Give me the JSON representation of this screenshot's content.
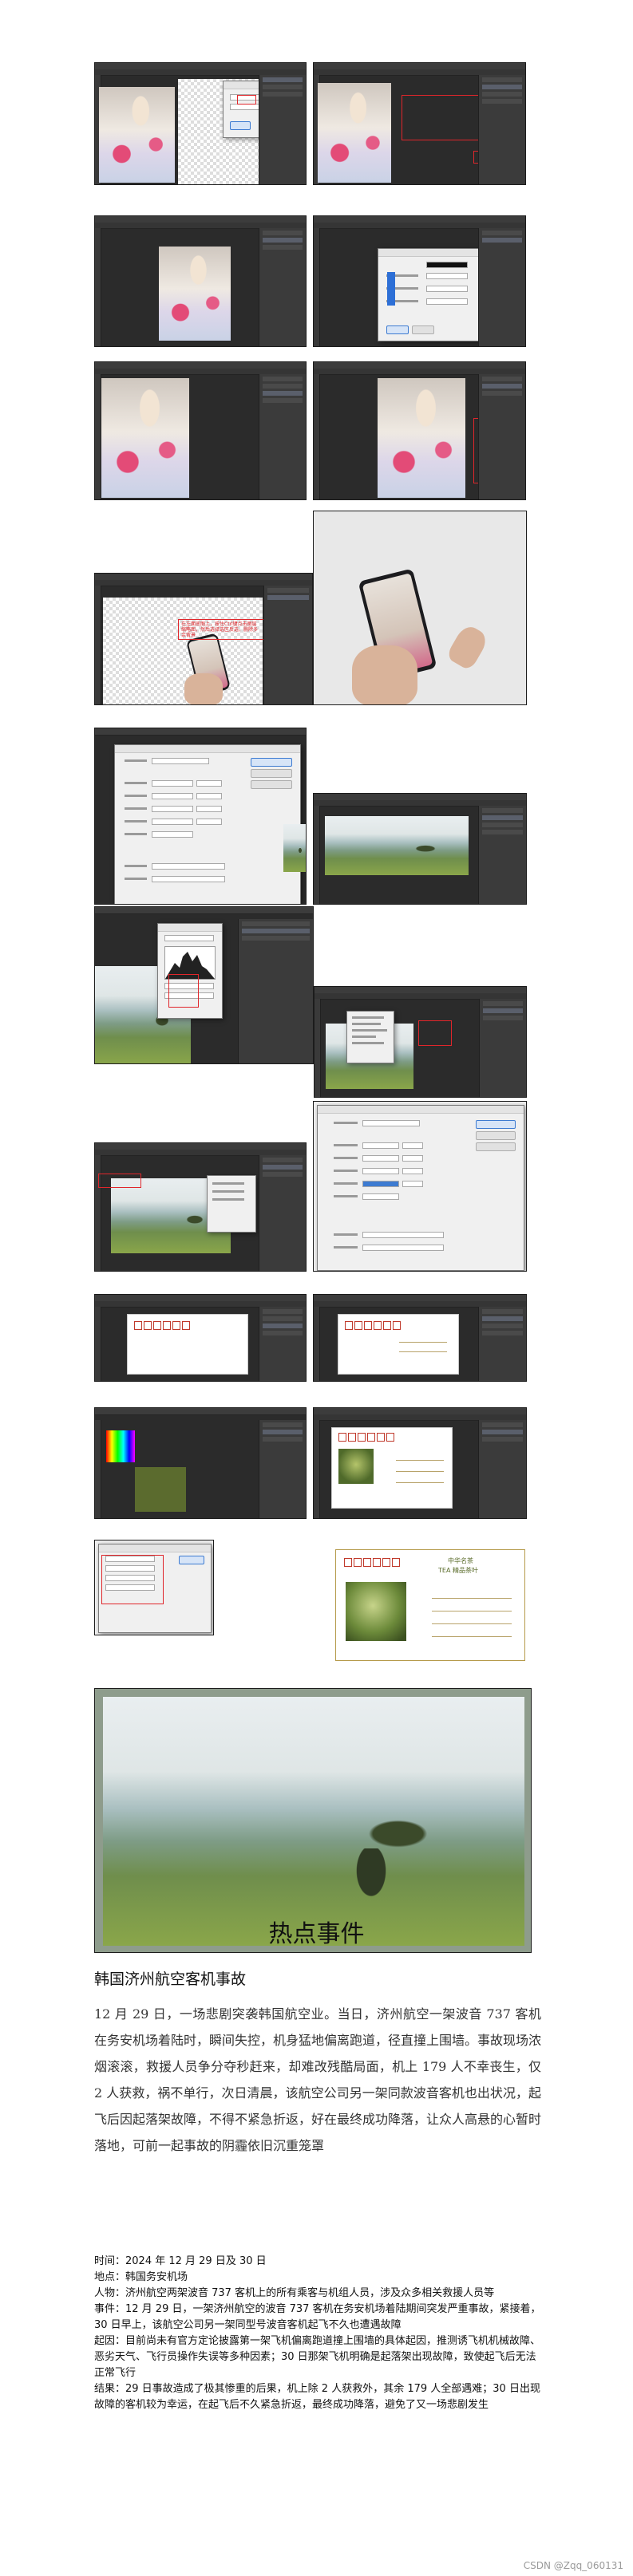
{
  "steps": [
    {
      "name": "step-1-open-portrait"
    },
    {
      "name": "step-2-select-subject"
    },
    {
      "name": "step-3-mask-portrait"
    },
    {
      "name": "step-4-refine-edge-dialog"
    },
    {
      "name": "step-5-layers-portrait"
    },
    {
      "name": "step-6-adjust-portrait"
    },
    {
      "name": "step-7-transparent-canvas"
    },
    {
      "name": "step-8-phone-photo"
    },
    {
      "name": "step-9-new-document-dialog"
    },
    {
      "name": "step-10-place-tea-photo"
    },
    {
      "name": "step-11-levels"
    },
    {
      "name": "step-12-context-menu"
    },
    {
      "name": "step-13-tea-layer"
    },
    {
      "name": "step-14-canvas-size-dialog"
    },
    {
      "name": "step-15-postcard-frame"
    },
    {
      "name": "step-16-postcard-frame-layers"
    },
    {
      "name": "step-17-color-picker"
    },
    {
      "name": "step-18-postcard-with-photo"
    },
    {
      "name": "step-19-character-panel"
    },
    {
      "name": "step-20-final-postcard"
    },
    {
      "name": "step-21-final-tea-image"
    }
  ],
  "annotations": {
    "step7_note": "在左面底图上，按住Ctrl键点击图层缩略图，然后选择选区反选，删除多余背景"
  },
  "postcard": {
    "title_line1": "中华名茶",
    "title_line2": "TEA  精品茶叶"
  },
  "article": {
    "heading": "热点事件",
    "title": "韩国济州航空客机事故",
    "body": "12 月 29 日，一场悲剧突袭韩国航空业。当日，济州航空一架波音 737 客机在务安机场着陆时，瞬间失控，机身猛地偏离跑道，径直撞上围墙。事故现场浓烟滚滚，救援人员争分夺秒赶来，却难改残酷局面，机上 179 人不幸丧生，仅 2 人获救，祸不单行，次日清晨，该航空公司另一架同款波音客机也出状况，起飞后因起落架故障，不得不紧急折返，好在最终成功降落，让众人高悬的心暂时落地，可前一起事故的阴霾依旧沉重笼罩",
    "facts": [
      "时间：2024 年 12 月 29 日及 30 日",
      "地点：韩国务安机场",
      "人物：济州航空两架波音 737 客机上的所有乘客与机组人员，涉及众多相关救援人员等",
      "事件：12 月 29 日，一架济州航空的波音 737 客机在务安机场着陆期间突发严重事故，紧接着，30 日早上，该航空公司另一架同型号波音客机起飞不久也遭遇故障",
      "起因：目前尚未有官方定论披露第一架飞机偏离跑道撞上围墙的具体起因，推测诱飞机机械故障、恶劣天气、飞行员操作失误等多种因素；30 日那架飞机明确是起落架出现故障，致使起飞后无法正常飞行",
      "结果：29 日事故造成了极其惨重的后果，机上除 2 人获救外，其余 179 人全部遇难；30 日出现故障的客机较为幸运，在起飞后不久紧急折返，最终成功降落，避免了又一场悲剧发生"
    ]
  },
  "watermark": "CSDN @Zqq_060131",
  "colors": {
    "ps_dark": "#2b2b2b",
    "panel": "#3b3b3b",
    "accent_red": "#e0262b",
    "tea_green": "#5b6b2e"
  }
}
